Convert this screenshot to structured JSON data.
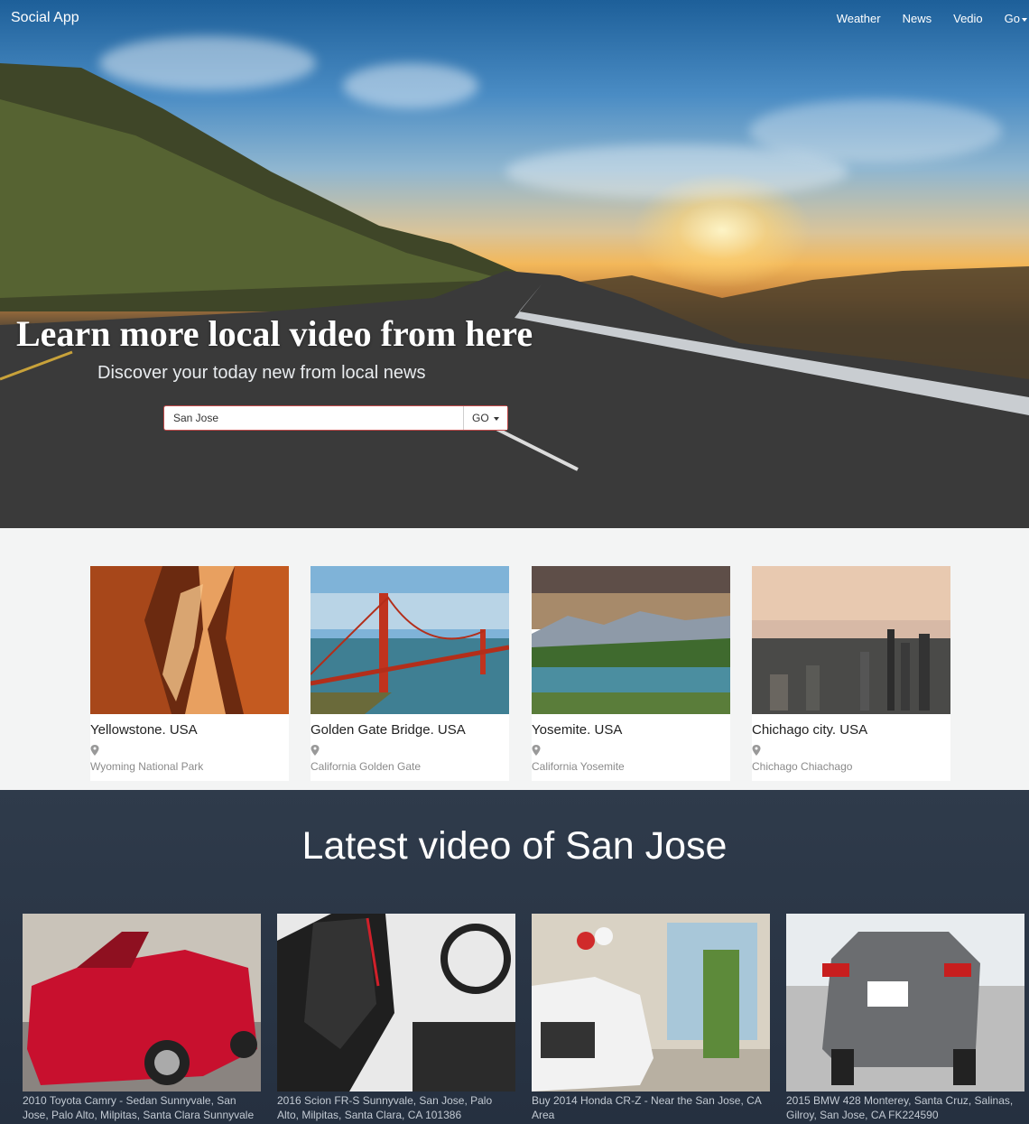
{
  "navbar": {
    "brand": "Social App",
    "links": [
      "Weather",
      "News",
      "Vedio",
      "Go"
    ]
  },
  "hero": {
    "title": "Learn more local video from here",
    "subtitle": "Discover your today new from local news",
    "search_value": "San Jose",
    "go_label": "GO"
  },
  "places": [
    {
      "title": "Yellowstone. USA",
      "location": "Wyoming National Park",
      "icon": "map-marker-icon"
    },
    {
      "title": "Golden Gate Bridge. USA",
      "location": "California Golden Gate",
      "icon": "map-marker-icon"
    },
    {
      "title": "Yosemite. USA",
      "location": "California Yosemite",
      "icon": "map-marker-icon"
    },
    {
      "title": "Chichago city. USA",
      "location": "Chichago Chiachago",
      "icon": "map-marker-icon"
    }
  ],
  "videos": {
    "heading": "Latest video of San Jose",
    "items": [
      {
        "caption": "2010 Toyota Camry - Sedan Sunnyvale, San Jose, Palo Alto, Milpitas, Santa Clara Sunnyvale"
      },
      {
        "caption": "2016 Scion FR-S Sunnyvale, San Jose, Palo Alto, Milpitas, Santa Clara, CA 101386"
      },
      {
        "caption": "Buy 2014 Honda CR-Z - Near the San Jose, CA Area"
      },
      {
        "caption": "2015 BMW 428 Monterey, Santa Cruz, Salinas, Gilroy, San Jose, CA FK224590"
      }
    ]
  }
}
